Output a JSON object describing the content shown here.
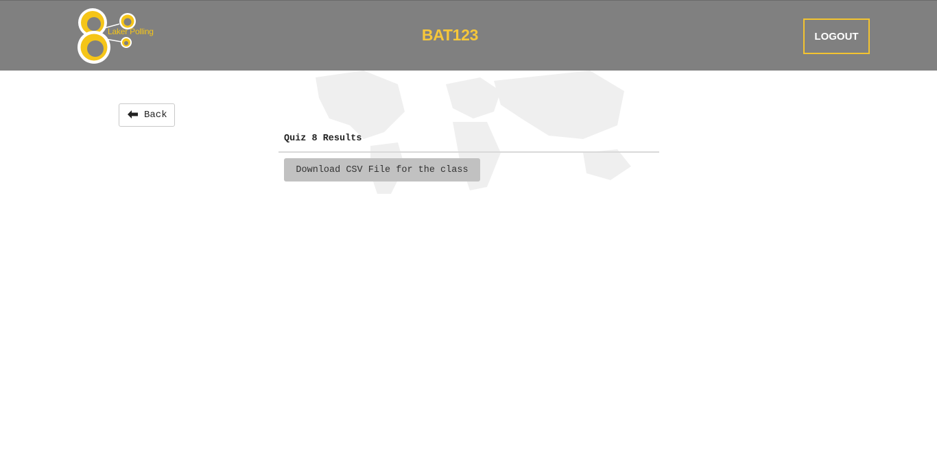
{
  "header": {
    "logo_text": "Laker Polling",
    "course_code": "BAT123",
    "logout_label": "LOGOUT"
  },
  "nav": {
    "back_label": "Back"
  },
  "results": {
    "heading": "Quiz 8 Results",
    "download_label": "Download CSV File for the class"
  },
  "colors": {
    "header_bg": "#808080",
    "accent_yellow": "#f6c73a",
    "button_gray": "#c1c1c1"
  },
  "icons": {
    "logo": "laker-polling-logo-icon",
    "back": "arrow-left-icon",
    "background": "world-map-icon"
  }
}
